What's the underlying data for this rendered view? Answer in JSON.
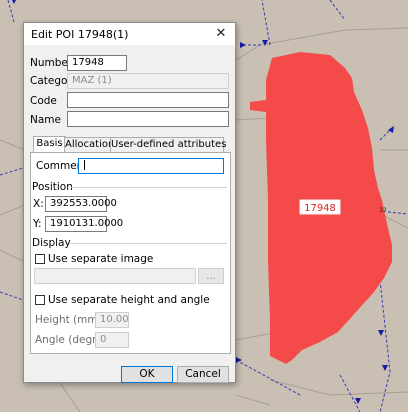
{
  "dialog": {
    "title": "Edit POI 17948(1)",
    "close_icon": "close-icon",
    "fields": {
      "number_label": "Number",
      "number_value": "17948",
      "category_label": "Category",
      "category_value": "MAZ (1)",
      "code_label": "Code",
      "code_value": "",
      "name_label": "Name",
      "name_value": ""
    },
    "tabs": [
      {
        "label": "Basis",
        "active": true
      },
      {
        "label": "Allocations",
        "active": false
      },
      {
        "label": "User-defined attributes",
        "active": false
      }
    ],
    "basis": {
      "comment_label": "Comment:",
      "comment_value": "",
      "position_group": "Position",
      "x_label": "X:",
      "x_value": "392553.0000",
      "y_label": "Y:",
      "y_value": "1910131.0000",
      "display_group": "Display",
      "use_separate_image_label": "Use separate image",
      "use_separate_image_checked": false,
      "image_path": "",
      "browse_label": "...",
      "use_separate_height_label": "Use separate height and angle",
      "use_separate_height_checked": false,
      "height_label": "Height (mm):",
      "height_value": "10.00",
      "angle_label": "Angle (degrees):",
      "angle_value": "0"
    },
    "ok_label": "OK",
    "cancel_label": "Cancel"
  },
  "map": {
    "zone_label": "17948",
    "edge_label": "32",
    "zone_color": "#f44a4a",
    "background_color": "#c9c0b3",
    "node_color": "#1a1aa8"
  }
}
